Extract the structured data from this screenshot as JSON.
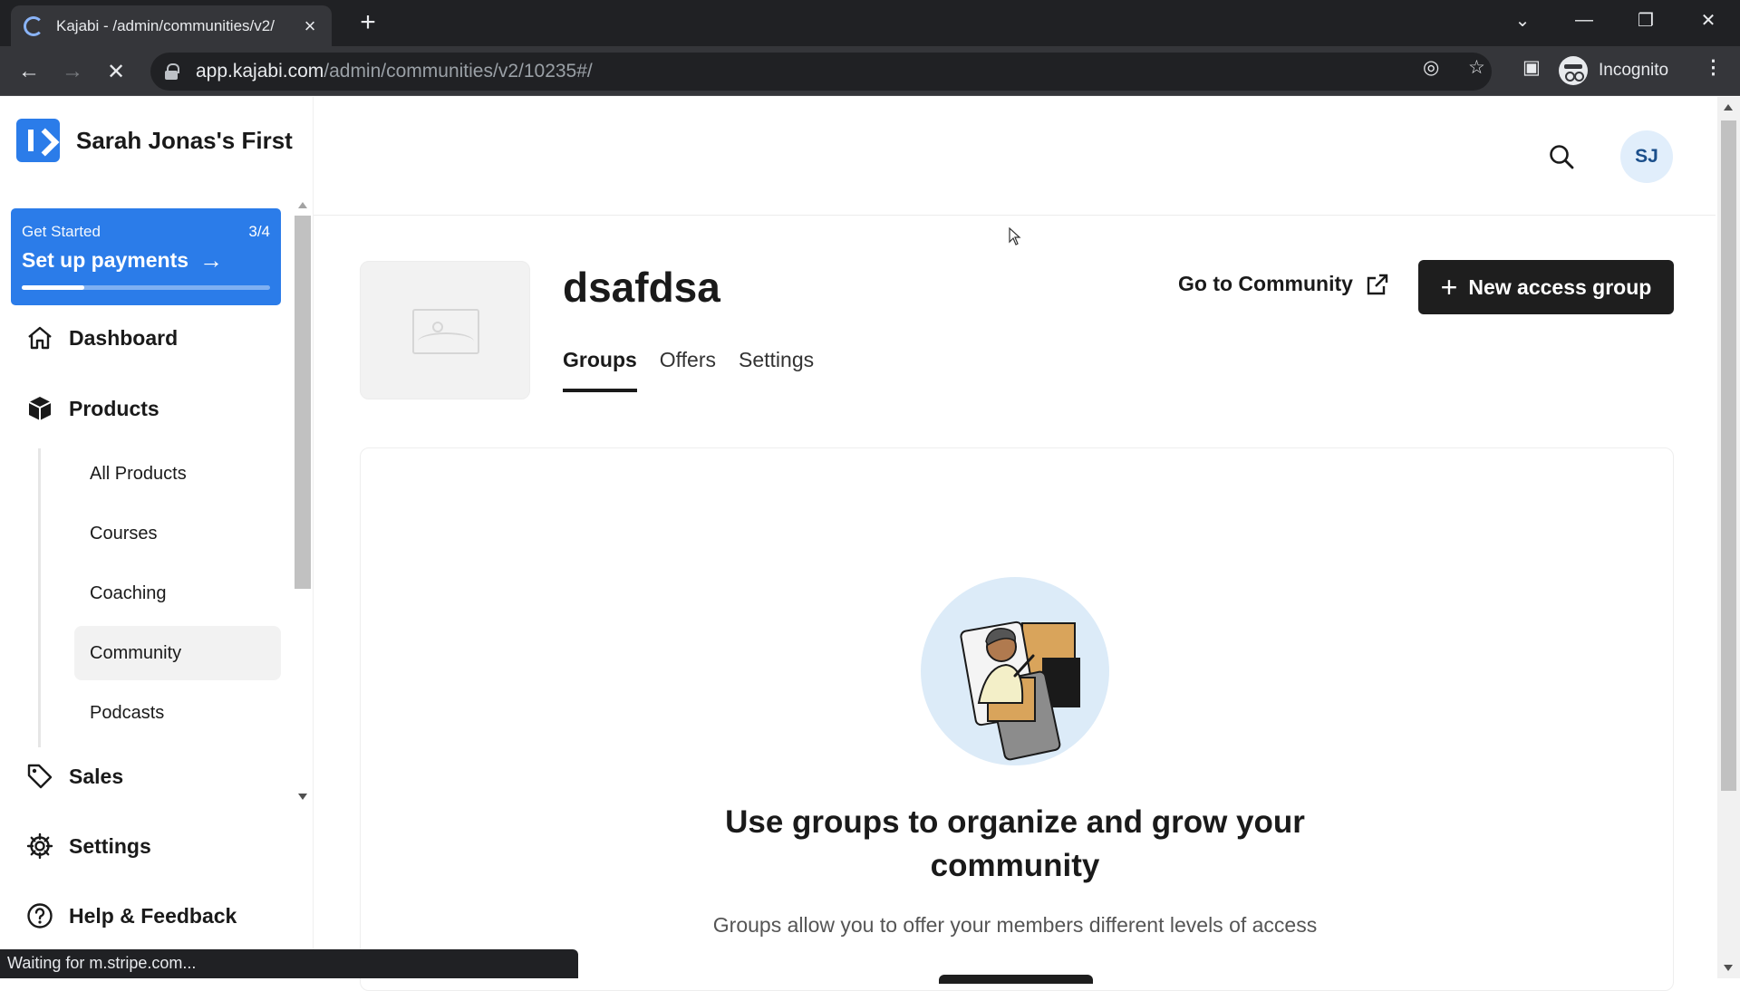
{
  "browser": {
    "tab_title": "Kajabi - /admin/communities/v2/",
    "url_host": "app.kajabi.com",
    "url_path": "/admin/communities/v2/10235#/",
    "incognito_label": "Incognito",
    "status_text": "Waiting for m.stripe.com..."
  },
  "sidebar": {
    "brand": "Sarah Jonas's First",
    "get_started": {
      "label": "Get Started",
      "count": "3/4",
      "title": "Set up payments",
      "progress": 0.25
    },
    "items": [
      {
        "label": "Dashboard",
        "icon": "home-icon"
      },
      {
        "label": "Products",
        "icon": "box-icon"
      },
      {
        "label": "Sales",
        "icon": "tag-icon"
      },
      {
        "label": "Settings",
        "icon": "gear-icon"
      },
      {
        "label": "Help & Feedback",
        "icon": "help-icon"
      }
    ],
    "sub_items": [
      {
        "label": "All Products"
      },
      {
        "label": "Courses"
      },
      {
        "label": "Coaching"
      },
      {
        "label": "Community",
        "active": true
      },
      {
        "label": "Podcasts"
      }
    ]
  },
  "header": {
    "avatar_initials": "SJ"
  },
  "page": {
    "title": "dsafdsa",
    "tabs": [
      {
        "label": "Groups",
        "active": true
      },
      {
        "label": "Offers"
      },
      {
        "label": "Settings"
      }
    ],
    "go_to_community": "Go to Community",
    "new_access_group": "New access group"
  },
  "empty_state": {
    "title": "Use groups to organize and grow your community",
    "subtitle": "Groups allow you to offer your members different levels of access"
  },
  "colors": {
    "accent": "#2b7ce9",
    "dark_button": "#1e1e1e"
  }
}
